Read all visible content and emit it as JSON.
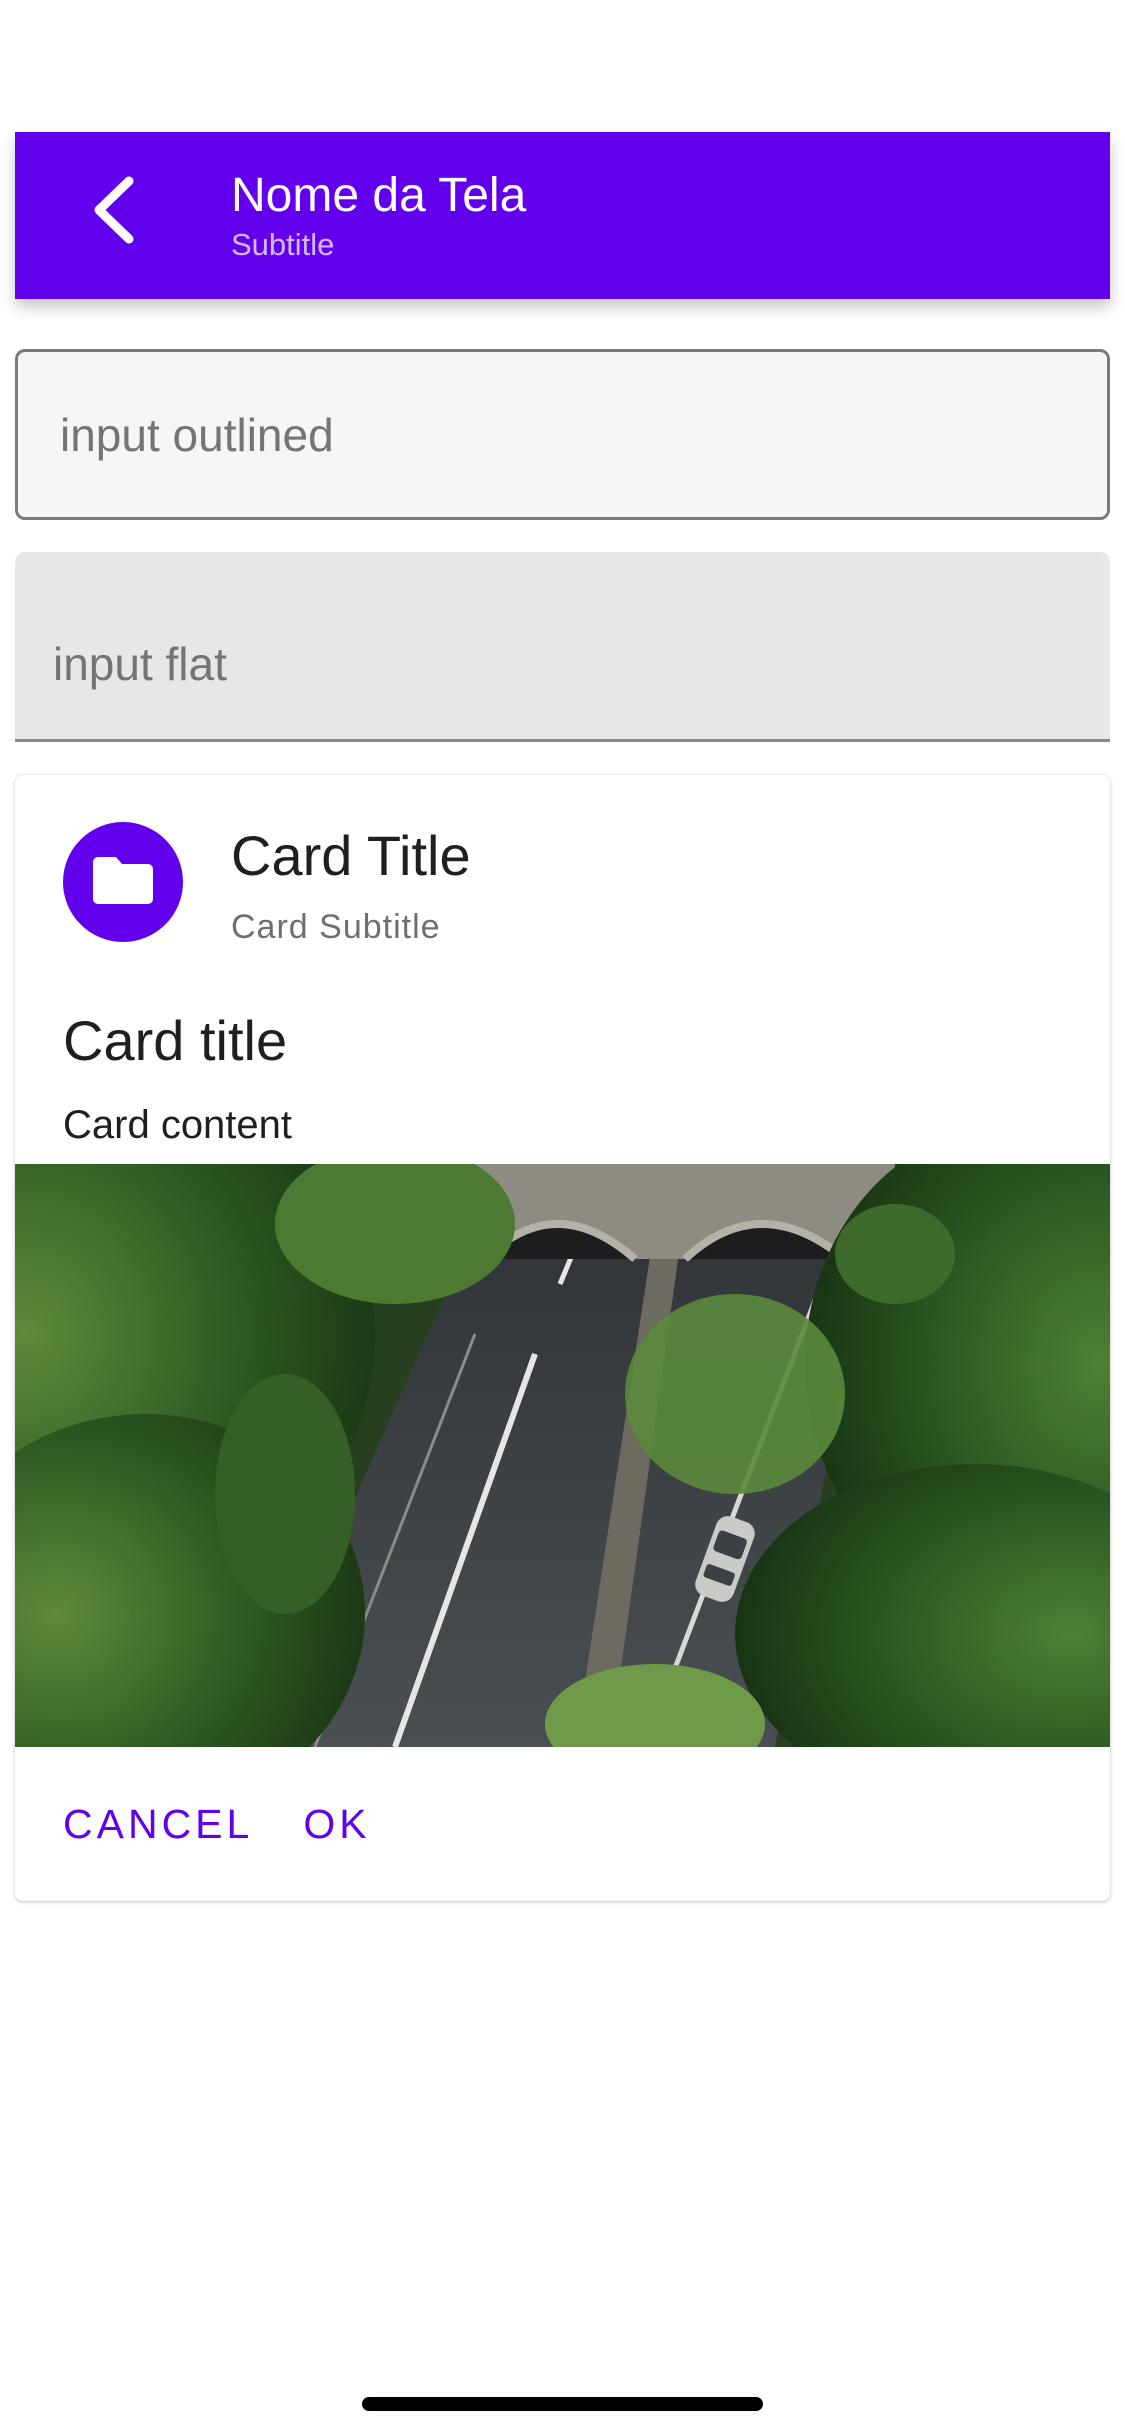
{
  "appbar": {
    "title": "Nome da Tela",
    "subtitle": "Subtitle",
    "back_icon": "chevron-left-icon"
  },
  "inputs": {
    "outlined_placeholder": "input outlined",
    "outlined_value": "",
    "flat_placeholder": "input flat",
    "flat_value": ""
  },
  "card": {
    "avatar_icon": "folder-icon",
    "header_title": "Card Title",
    "header_subtitle": "Card Subtitle",
    "title": "Card title",
    "content": "Card content",
    "cover_image": "aerial-road-tunnel-with-trees",
    "actions": {
      "cancel_label": "CANCEL",
      "ok_label": "OK"
    }
  },
  "colors": {
    "primary": "#6200ee",
    "background": "#ffffff",
    "outlined_input_bg": "#f6f6f6",
    "flat_input_bg": "#e7e7e7",
    "text_primary": "#1f1f1f",
    "text_secondary": "#6f6f6f"
  }
}
